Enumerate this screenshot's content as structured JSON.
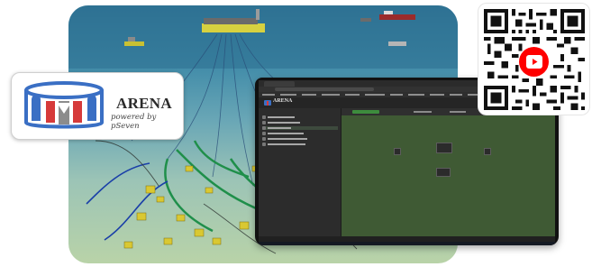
{
  "logo": {
    "title": "ARENA",
    "subtitle": "powered by pSeven",
    "colors": {
      "blue": "#3a6fc4",
      "red": "#d63a3a",
      "gray": "#8c8c8c"
    }
  },
  "scene": {
    "icon": "offshore-oil-field-illustration",
    "colors": {
      "sea_top": "#2f7597",
      "seabed": "#b9d3a8",
      "vessel": "#c9c132",
      "flowline": "#1f8f4a",
      "cable": "#1a3fa8"
    }
  },
  "app_window": {
    "icon": "pseven-arena-app-screenshot",
    "app_name": "ARENA",
    "colors": {
      "canvas": "#3f5a34",
      "run": "#3d8c3d",
      "panel": "#2c2c2c"
    }
  },
  "qr": {
    "icon": "qr-code",
    "badge_icon": "youtube-play-icon",
    "colors": {
      "badge": "#ff0000"
    }
  }
}
